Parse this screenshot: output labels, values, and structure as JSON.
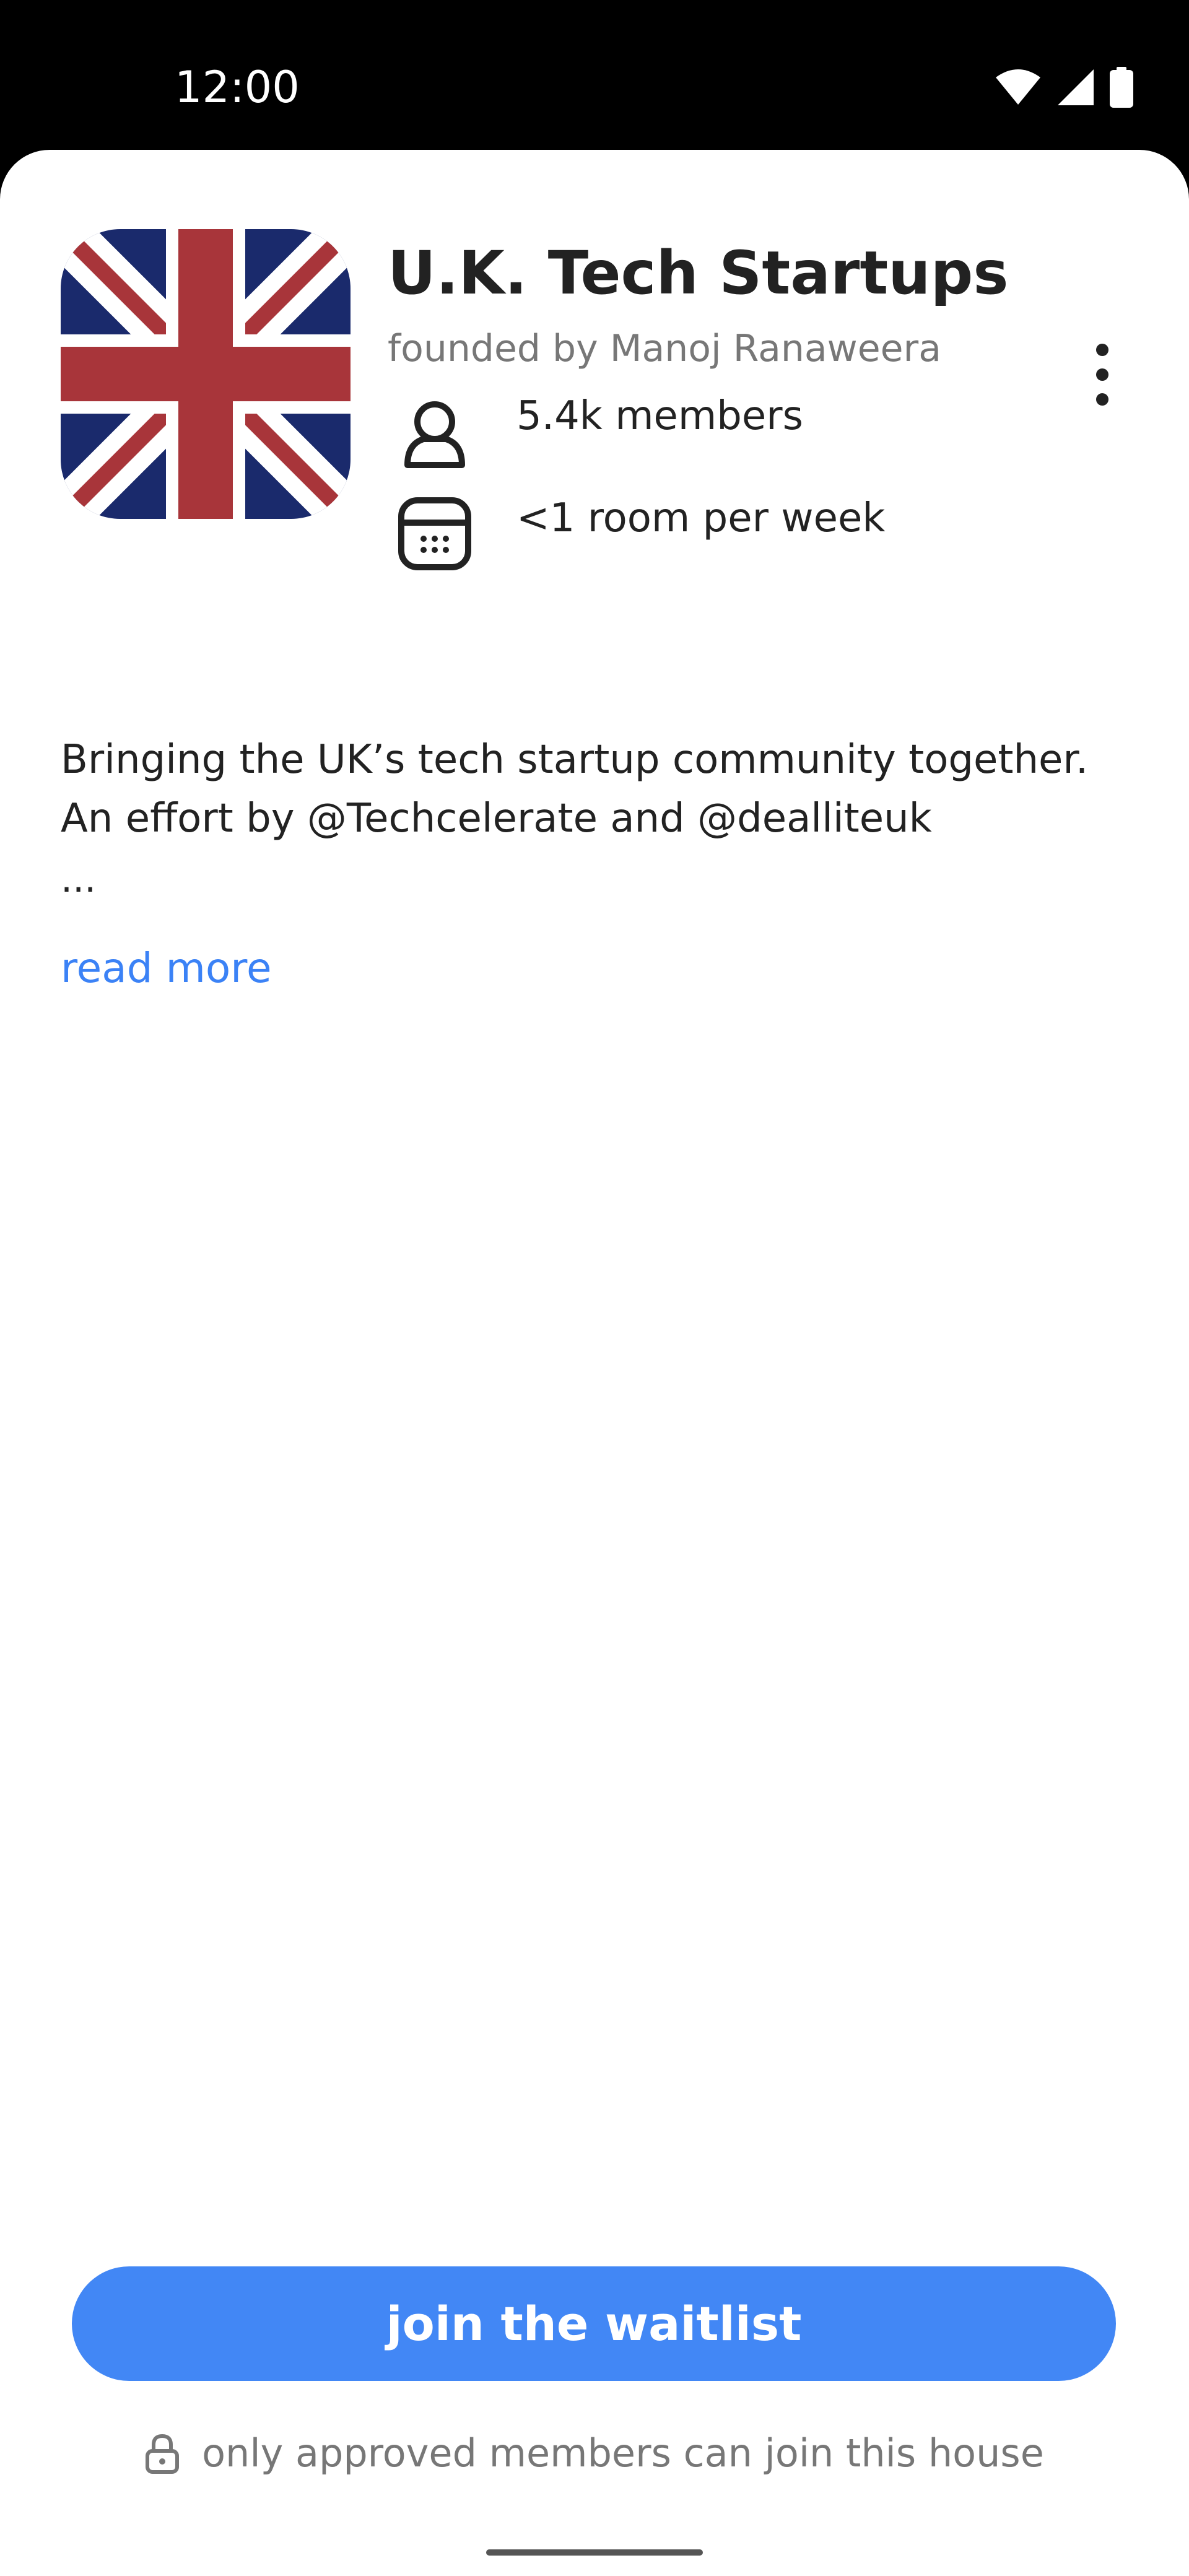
{
  "status_bar": {
    "time": "12:00",
    "icons": [
      "wifi-icon",
      "signal-icon",
      "battery-icon"
    ]
  },
  "house": {
    "title": "U.K. Tech Startups",
    "founder": "founded by Manoj Ranaweera",
    "members": "5.4k members",
    "rooms": "<1 room per week",
    "description": "Bringing the UK’s tech startup community together.  An effort by @Techcelerate and @dealliteuk",
    "ellipsis": "...",
    "read_more": "read more"
  },
  "actions": {
    "join_label": "join the waitlist",
    "notice": "only approved members can join this house"
  },
  "colors": {
    "accent": "#4287f5",
    "link": "#3b82f6",
    "text": "#222222",
    "muted": "#777777",
    "flag_blue": "#1a2a6c",
    "flag_red": "#a8353a"
  }
}
